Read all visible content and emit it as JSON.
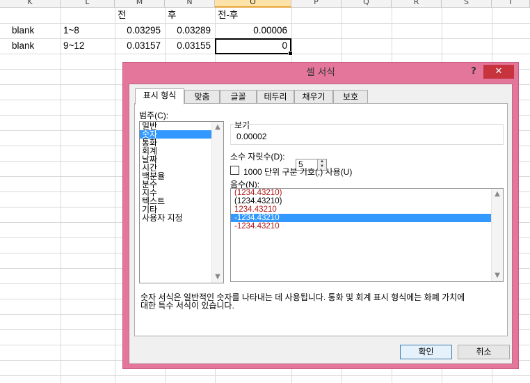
{
  "columns": [
    "K",
    "L",
    "M",
    "N",
    "O",
    "P",
    "Q",
    "R",
    "S",
    "T"
  ],
  "selected_column": "O",
  "header_row": {
    "m": "전",
    "n": "후",
    "o": "전-후"
  },
  "rows": [
    {
      "k": "blank",
      "l": "1~8",
      "m": "0.03295",
      "n": "0.03289",
      "o": "0.00006"
    },
    {
      "k": "blank",
      "l": "9~12",
      "m": "0.03157",
      "n": "0.03155",
      "o": "0"
    }
  ],
  "dialog": {
    "title": "셀 서식",
    "help_label": "?",
    "close_label": "✕",
    "tabs": [
      {
        "label": "표시 형식",
        "active": true
      },
      {
        "label": "맞춤"
      },
      {
        "label": "글꼴"
      },
      {
        "label": "테두리"
      },
      {
        "label": "채우기"
      },
      {
        "label": "보호"
      }
    ],
    "category_label": "범주(C):",
    "categories": [
      "일반",
      "숫자",
      "통화",
      "회계",
      "날짜",
      "시간",
      "백분율",
      "분수",
      "지수",
      "텍스트",
      "기타",
      "사용자 지정"
    ],
    "selected_category": "숫자",
    "sample_label": "보기",
    "sample_value": "0.00002",
    "decimal_label": "소수 자릿수(D):",
    "decimal_value": "5",
    "thousands_label": "1000 단위 구분 기호(,) 사용(U)",
    "thousands_checked": false,
    "negative_label": "음수(N):",
    "negative_formats": [
      {
        "text": "(1234.43210)",
        "color": "red"
      },
      {
        "text": "(1234.43210)",
        "color": "black"
      },
      {
        "text": "1234.43210",
        "color": "red"
      },
      {
        "text": "-1234.43210",
        "color": "black",
        "selected": true
      },
      {
        "text": "-1234.43210",
        "color": "red"
      }
    ],
    "description_line1": "숫자 서식은 일반적인 숫자를 나타내는 데 사용됩니다. 통화 및 회계 표시 형식에는 화폐 가치에",
    "description_line2": "대한 특수 서식이 있습니다.",
    "ok_label": "확인",
    "cancel_label": "취소"
  },
  "colors": {
    "dialog_frame": "#e4769b",
    "close_button": "#c7343e",
    "selection": "#3399ff",
    "negative_red": "#b01717",
    "column_highlight": "#fde3a7"
  }
}
